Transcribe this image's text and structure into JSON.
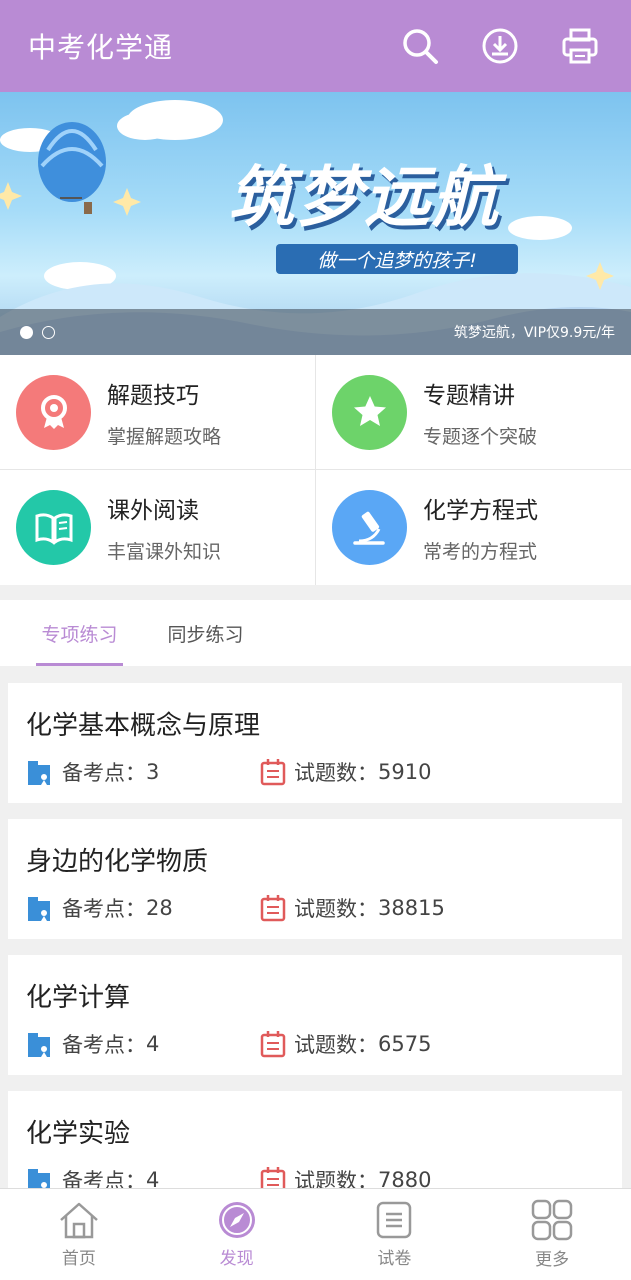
{
  "app": {
    "title": "中考化学通",
    "header_icons": [
      "search-icon",
      "download-icon",
      "print-icon"
    ]
  },
  "banner": {
    "headline": "筑梦远航",
    "tagline": "做一个追梦的孩子!",
    "caption": "筑梦远航，VIP仅9.9元/年",
    "slide_count": 2,
    "active_slide": 1
  },
  "features": [
    {
      "title": "解题技巧",
      "subtitle": "掌握解题攻略",
      "icon": "badge-icon",
      "color": "#f47a7a"
    },
    {
      "title": "专题精讲",
      "subtitle": "专题逐个突破",
      "icon": "star-icon",
      "color": "#6dd36a"
    },
    {
      "title": "课外阅读",
      "subtitle": "丰富课外知识",
      "icon": "book-icon",
      "color": "#23c8a8"
    },
    {
      "title": "化学方程式",
      "subtitle": "常考的方程式",
      "icon": "microscope-icon",
      "color": "#5aa7f5"
    }
  ],
  "tabs": [
    {
      "label": "专项练习",
      "active": true
    },
    {
      "label": "同步练习",
      "active": false
    }
  ],
  "topics": [
    {
      "title": "化学基本概念与原理",
      "points_label": "备考点：",
      "points": "3",
      "questions_label": "试题数：",
      "questions": "5910"
    },
    {
      "title": "身边的化学物质",
      "points_label": "备考点：",
      "points": "28",
      "questions_label": "试题数：",
      "questions": "38815"
    },
    {
      "title": "化学计算",
      "points_label": "备考点：",
      "points": "4",
      "questions_label": "试题数：",
      "questions": "6575"
    },
    {
      "title": "化学实验",
      "points_label": "备考点：",
      "points": "4",
      "questions_label": "试题数：",
      "questions": "7880"
    }
  ],
  "bottom_nav": [
    {
      "label": "首页",
      "icon": "home-icon",
      "active": false
    },
    {
      "label": "发现",
      "icon": "compass-icon",
      "active": true
    },
    {
      "label": "试卷",
      "icon": "paper-icon",
      "active": false
    },
    {
      "label": "更多",
      "icon": "grid-icon",
      "active": false
    }
  ],
  "colors": {
    "accent": "#b98bd4",
    "points_icon": "#3a8fd8",
    "questions_icon": "#e05a5a"
  }
}
